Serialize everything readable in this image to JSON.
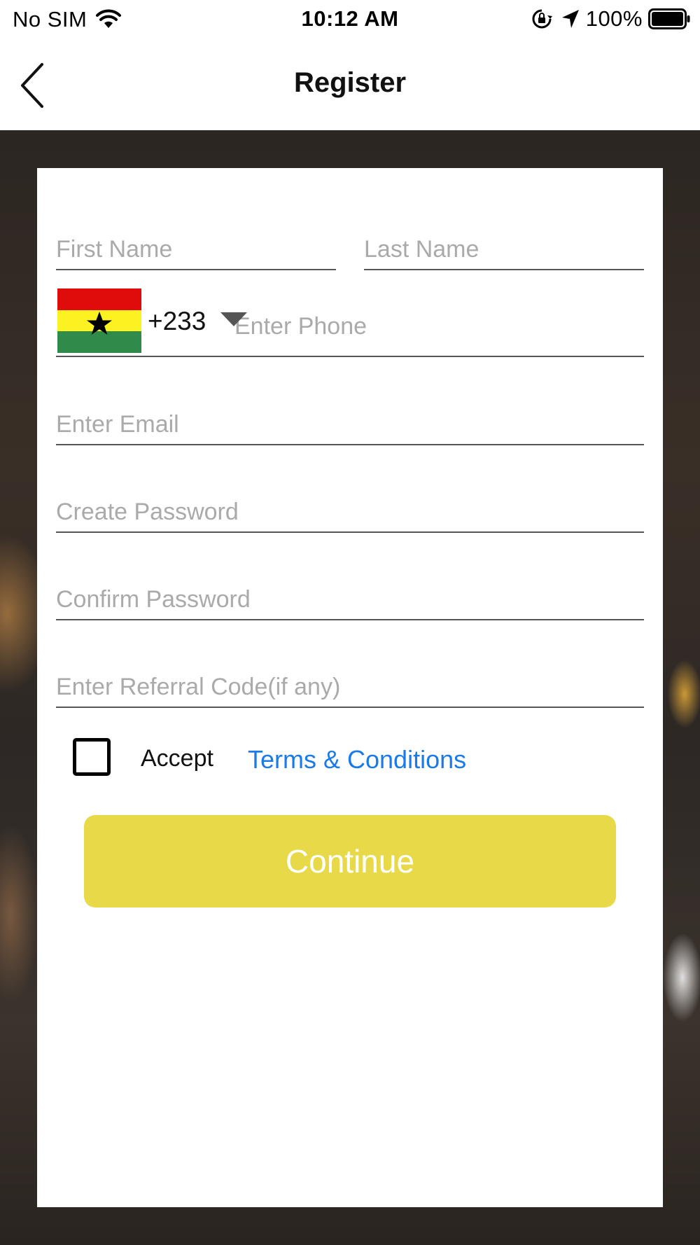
{
  "status_bar": {
    "carrier": "No SIM",
    "time": "10:12 AM",
    "battery_percent": "100%",
    "icons": [
      "wifi-icon",
      "orientation-lock-icon",
      "location-arrow-icon",
      "battery-icon"
    ]
  },
  "nav": {
    "title": "Register",
    "back_icon": "chevron-left-icon"
  },
  "form": {
    "first_name": {
      "placeholder": "First Name",
      "value": ""
    },
    "last_name": {
      "placeholder": "Last Name",
      "value": ""
    },
    "phone": {
      "country_flag": "ghana-flag",
      "dial_code": "+233",
      "placeholder": "Enter Phone",
      "value": ""
    },
    "email": {
      "placeholder": "Enter Email",
      "value": ""
    },
    "password": {
      "placeholder": "Create Password",
      "value": ""
    },
    "confirm_password": {
      "placeholder": "Confirm Password",
      "value": ""
    },
    "referral": {
      "placeholder": "Enter Referral Code(if any)",
      "value": ""
    },
    "terms": {
      "checked": false,
      "accept_label": "Accept",
      "link_label": "Terms & Conditions"
    },
    "continue_label": "Continue"
  },
  "colors": {
    "accent_button": "#e8d948",
    "link": "#1a7ae8",
    "placeholder": "#aaaaaa"
  }
}
